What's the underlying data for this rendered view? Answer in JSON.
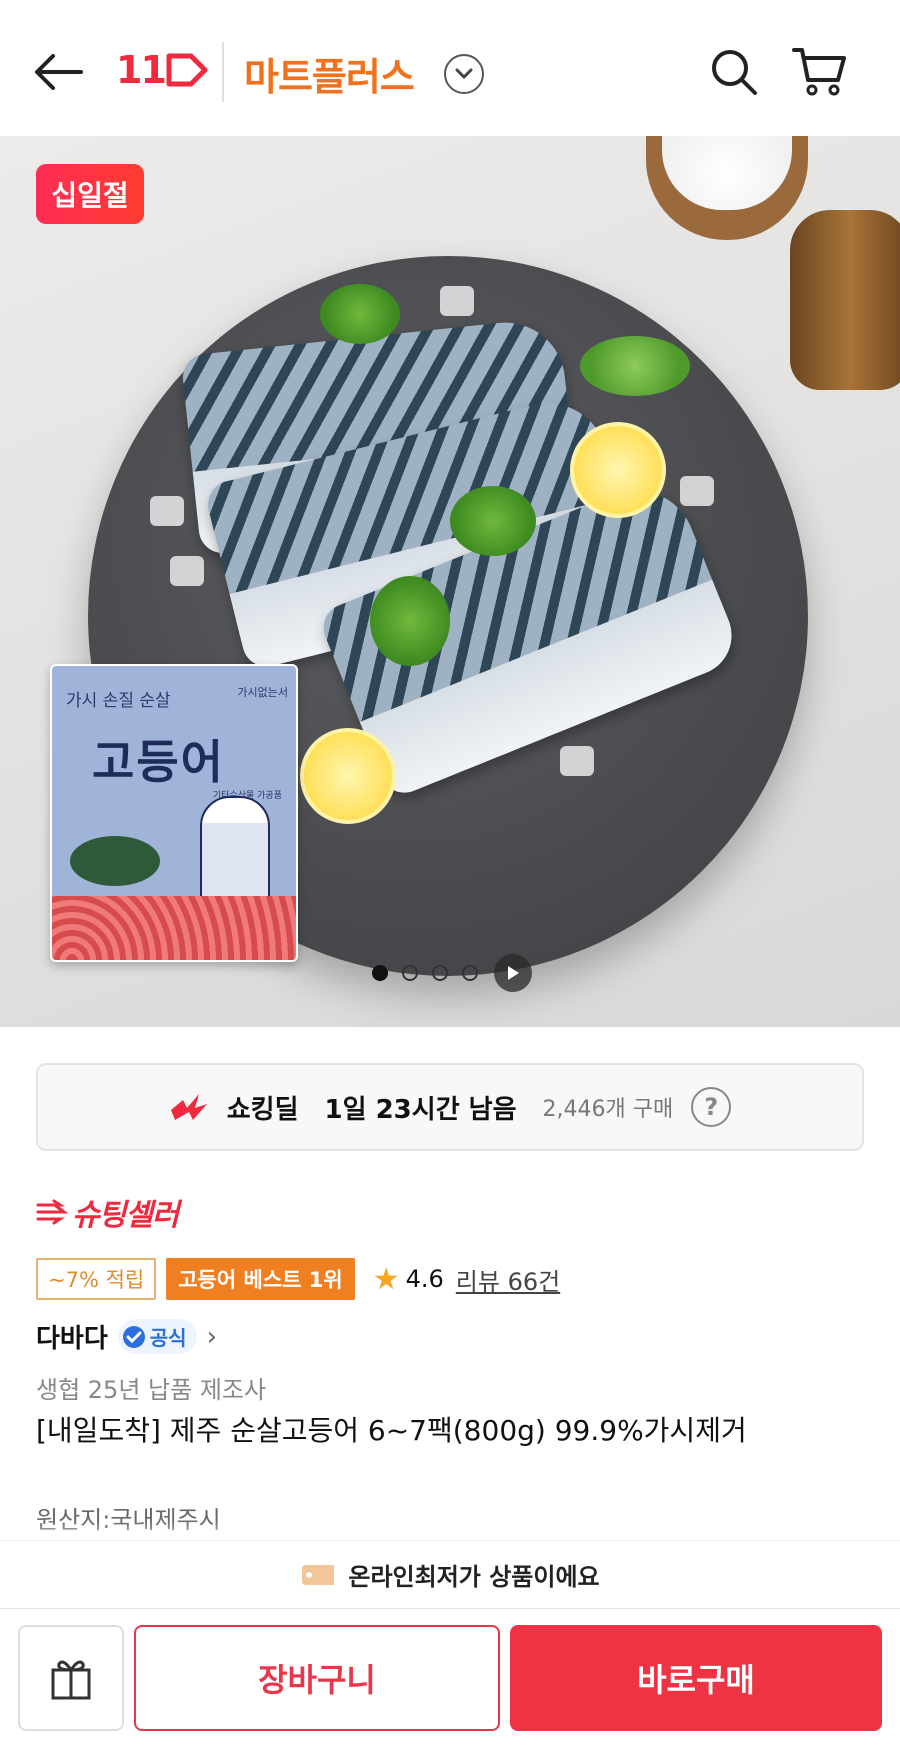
{
  "header": {
    "logo_text": "11",
    "mart_title": "마트플러스"
  },
  "hero": {
    "badge": "십일절",
    "package": {
      "top_text": "가시 손질 순살",
      "small_text": "가시없는서",
      "main_text": "고등어",
      "sub_text": "기타수산물 가공품"
    },
    "carousel": {
      "total": 4,
      "active_index": 0
    }
  },
  "deal": {
    "name": "쇼킹딜",
    "remaining": "1일 23시간 남음",
    "purchase_count": "2,446개 구매",
    "help": "?"
  },
  "product": {
    "shooting_seller": "슈팅셀러",
    "point_badge": "~7% 적립",
    "best_badge": "고등어 베스트 1위",
    "rating": "4.6",
    "review_link": "리뷰 66건",
    "seller_name": "다바다",
    "official_label": "공식",
    "subtitle": "생협 25년 납품 제조사",
    "title": "[내일도착] 제주 순살고등어 6~7팩(800g) 99.9%가시제거",
    "origin": "원산지:국내제주시"
  },
  "lowest_notice": "온라인최저가 상품이에요",
  "bottom_bar": {
    "cart_label": "장바구니",
    "buy_label": "바로구매"
  },
  "colors": {
    "accent_orange": "#f2711c",
    "accent_red": "#ee3344",
    "best_badge": "#f07f21",
    "official_blue": "#2a6fdb"
  }
}
